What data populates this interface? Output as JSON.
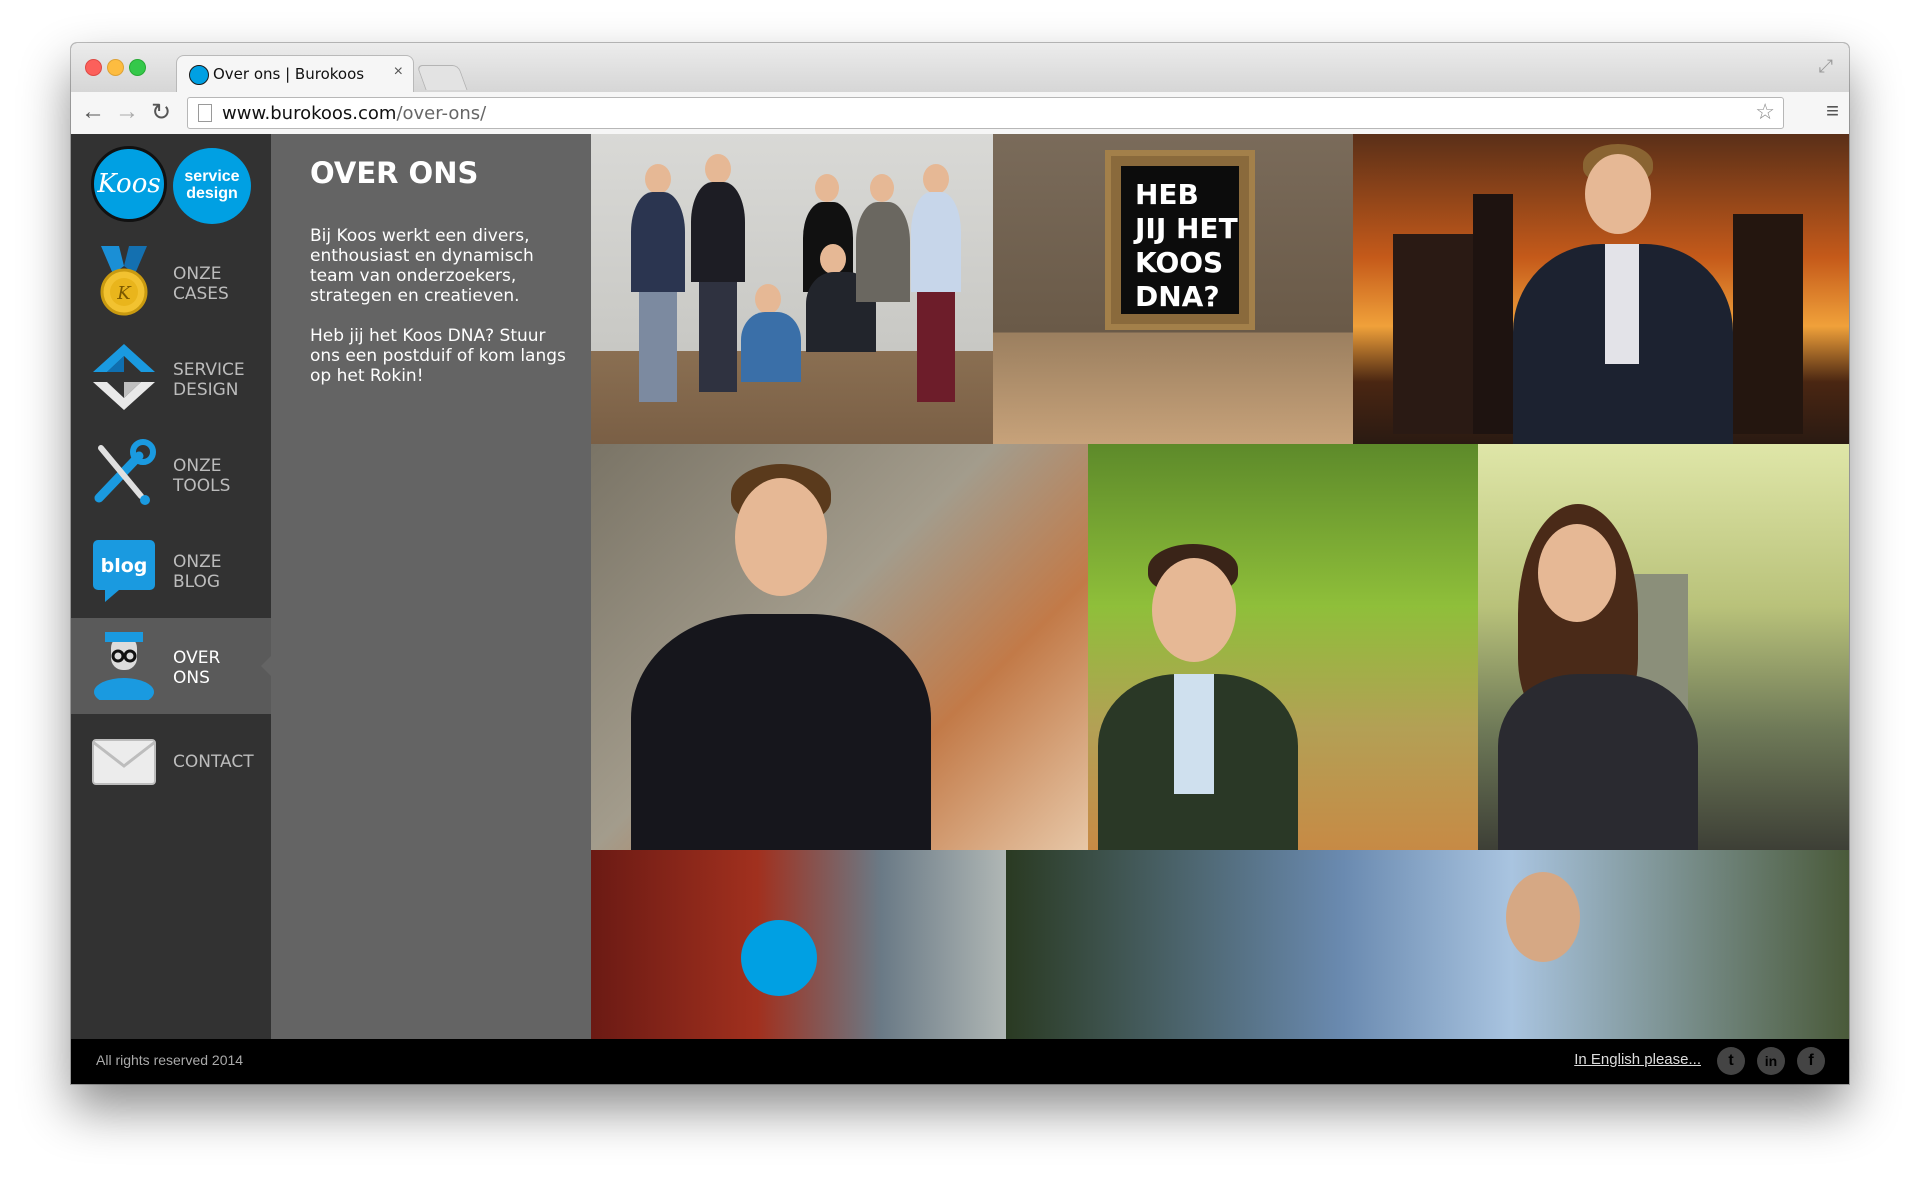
{
  "browser": {
    "tab_title": "Over ons | Burokoos",
    "tab_close": "×",
    "url_domain": "www.burokoos.com",
    "url_path": "/over-ons/",
    "back": "←",
    "forward": "→",
    "reload": "↻",
    "star": "☆",
    "menu": "≡",
    "fullscreen": "⤢"
  },
  "logo": {
    "koos": "Koos",
    "service_design": "service design"
  },
  "nav": [
    {
      "line1": "ONZE",
      "line2": "CASES",
      "icon": "medal-icon"
    },
    {
      "line1": "SERVICE",
      "line2": "DESIGN",
      "icon": "service-design-icon"
    },
    {
      "line1": "ONZE",
      "line2": "TOOLS",
      "icon": "tools-icon"
    },
    {
      "line1": "ONZE",
      "line2": "BLOG",
      "icon": "blog-icon",
      "badge": "blog"
    },
    {
      "line1": "OVER",
      "line2": "ONS",
      "icon": "koos-avatar-icon",
      "active": true
    },
    {
      "line1": "CONTACT",
      "line2": "",
      "icon": "envelope-icon"
    }
  ],
  "panel": {
    "title": "OVER ONS",
    "p1": "Bij Koos werkt een divers, enthousiast en dynamisch team van onderzoekers, strategen en creatieven.",
    "p2": "Heb jij het Koos DNA? Stuur ons een postduif of kom langs op het Rokin!"
  },
  "tiles": {
    "dna_sign": "HEB JIJ HET KOOS DNA?"
  },
  "footer": {
    "copyright": "All rights reserved 2014",
    "english_link": "In English please...",
    "twitter": "t",
    "linkedin": "in",
    "facebook": "f"
  },
  "colors": {
    "brand_blue": "#00a0e3",
    "sidebar": "#323232",
    "panel": "#646464",
    "footer": "#000000"
  }
}
